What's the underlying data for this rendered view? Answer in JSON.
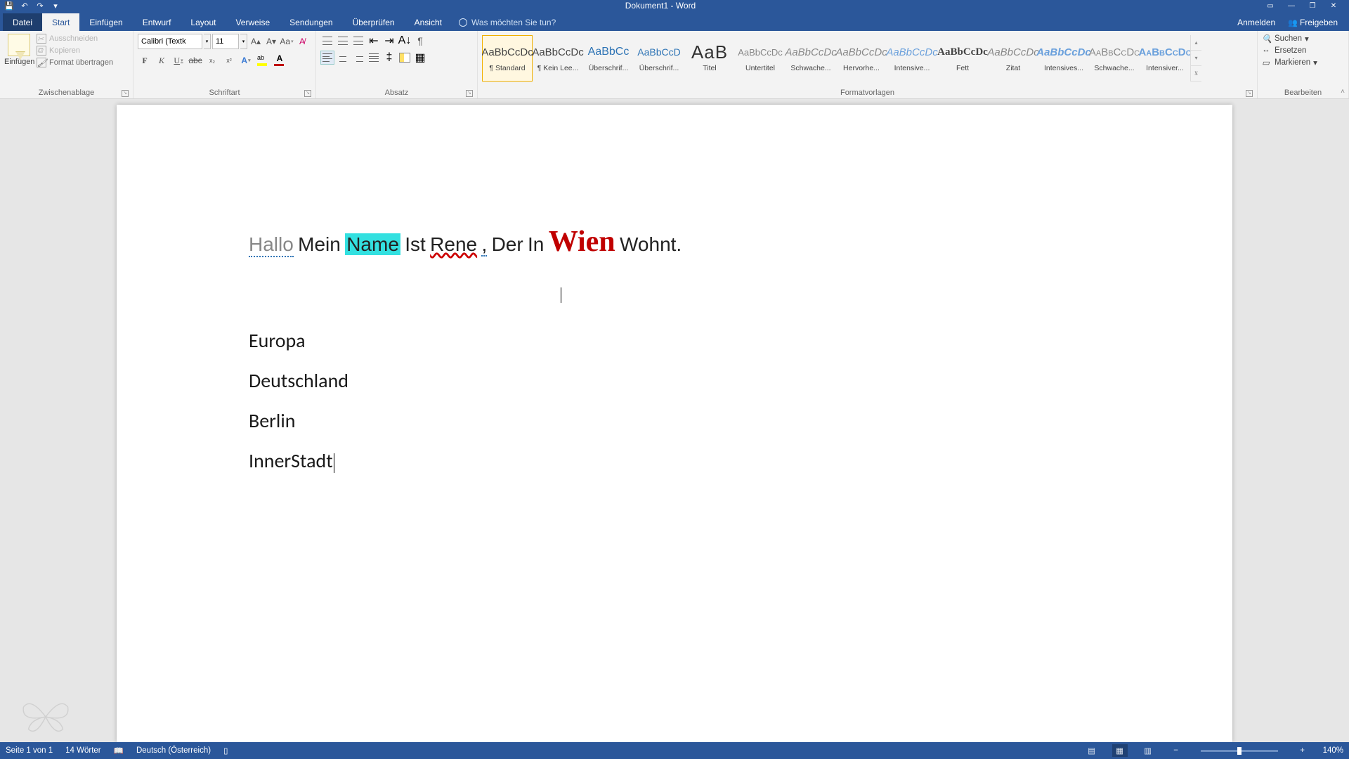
{
  "qat": {
    "save": "💾",
    "undo": "↶",
    "redo": "↷",
    "touch": "👆"
  },
  "title": "Dokument1 - Word",
  "window": {
    "ribbon_opts": "▭",
    "min": "—",
    "max": "❐",
    "close": "✕"
  },
  "tabs": {
    "file": "Datei",
    "items": [
      "Start",
      "Einfügen",
      "Entwurf",
      "Layout",
      "Verweise",
      "Sendungen",
      "Überprüfen",
      "Ansicht"
    ],
    "active_index": 0,
    "tell_me": "Was möchten Sie tun?",
    "sign_in": "Anmelden",
    "share": "Freigeben"
  },
  "ribbon": {
    "clipboard": {
      "paste": "Einfügen",
      "cut": "Ausschneiden",
      "copy": "Kopieren",
      "format_painter": "Format übertragen",
      "label": "Zwischenablage"
    },
    "font": {
      "name": "Calibri (Textk",
      "size": "11",
      "label": "Schriftart"
    },
    "paragraph": {
      "label": "Absatz"
    },
    "styles": {
      "label": "Formatvorlagen",
      "items": [
        {
          "preview": "AaBbCcDc",
          "name": "¶ Standard",
          "cls": ""
        },
        {
          "preview": "AaBbCcDc",
          "name": "¶ Kein Lee...",
          "cls": ""
        },
        {
          "preview": "AaBbCc",
          "name": "Überschrif...",
          "cls": "h1"
        },
        {
          "preview": "AaBbCcD",
          "name": "Überschrif...",
          "cls": "h2"
        },
        {
          "preview": "AaB",
          "name": "Titel",
          "cls": "title"
        },
        {
          "preview": "AaBbCcDc",
          "name": "Untertitel",
          "cls": "sub"
        },
        {
          "preview": "AaBbCcDc",
          "name": "Schwache...",
          "cls": "emph"
        },
        {
          "preview": "AaBbCcDc",
          "name": "Hervorhe...",
          "cls": "emph"
        },
        {
          "preview": "AaBbCcDc",
          "name": "Intensive...",
          "cls": "int-emph"
        },
        {
          "preview": "AaBbCcDc",
          "name": "Fett",
          "cls": "bold"
        },
        {
          "preview": "AaBbCcDc",
          "name": "Zitat",
          "cls": "quote"
        },
        {
          "preview": "AaBbCcDc",
          "name": "Intensives...",
          "cls": "int-quote"
        },
        {
          "preview": "AaBbCcDc",
          "name": "Schwache...",
          "cls": "ref"
        },
        {
          "preview": "AaBbCcDc",
          "name": "Intensiver...",
          "cls": "int-ref"
        }
      ]
    },
    "editing": {
      "find": "Suchen",
      "replace": "Ersetzen",
      "select": "Markieren",
      "label": "Bearbeiten"
    }
  },
  "document": {
    "line1": {
      "hallo": "Hallo",
      "mein": "Mein",
      "name": "Name",
      "ist": "Ist",
      "rene": "Rene",
      "comma": ",",
      "der": "Der",
      "in": "In",
      "wien": "Wien",
      "wohnt": "Wohnt."
    },
    "headings": [
      "Europa",
      "Deutschland",
      "Berlin",
      "InnerStadt"
    ]
  },
  "status": {
    "page": "Seite 1 von 1",
    "words": "14 Wörter",
    "lang": "Deutsch (Österreich)",
    "zoom": "140%"
  }
}
